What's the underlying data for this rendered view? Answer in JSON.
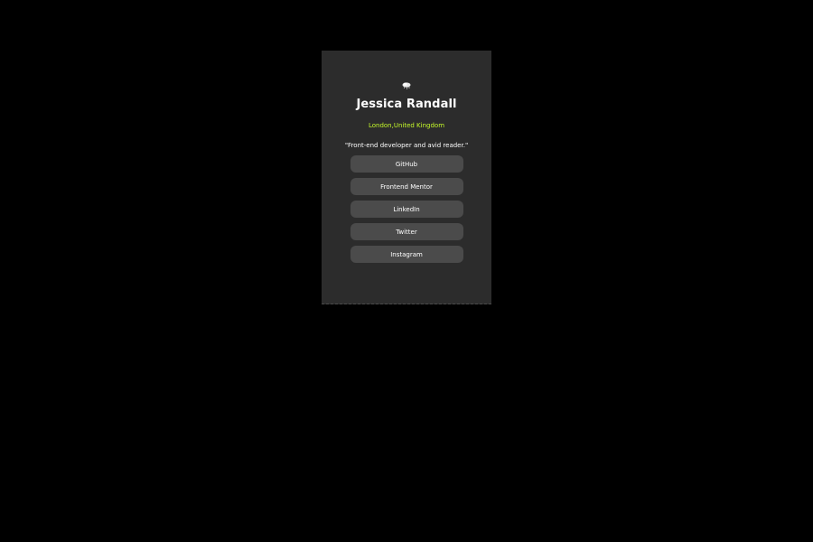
{
  "profile": {
    "avatar_icon": "profile-image-icon",
    "name": "Jessica Randall",
    "location": "London,United Kingdom",
    "bio": "\"Front-end developer and avid reader.\""
  },
  "links": [
    {
      "label": "GitHub"
    },
    {
      "label": "Frontend Mentor"
    },
    {
      "label": "LinkedIn"
    },
    {
      "label": "Twitter"
    },
    {
      "label": "Instagram"
    }
  ],
  "colors": {
    "background": "#000000",
    "card": "#2c2c2c",
    "button": "#4b4b4b",
    "accent": "#c4f82a",
    "text": "#ffffff"
  }
}
